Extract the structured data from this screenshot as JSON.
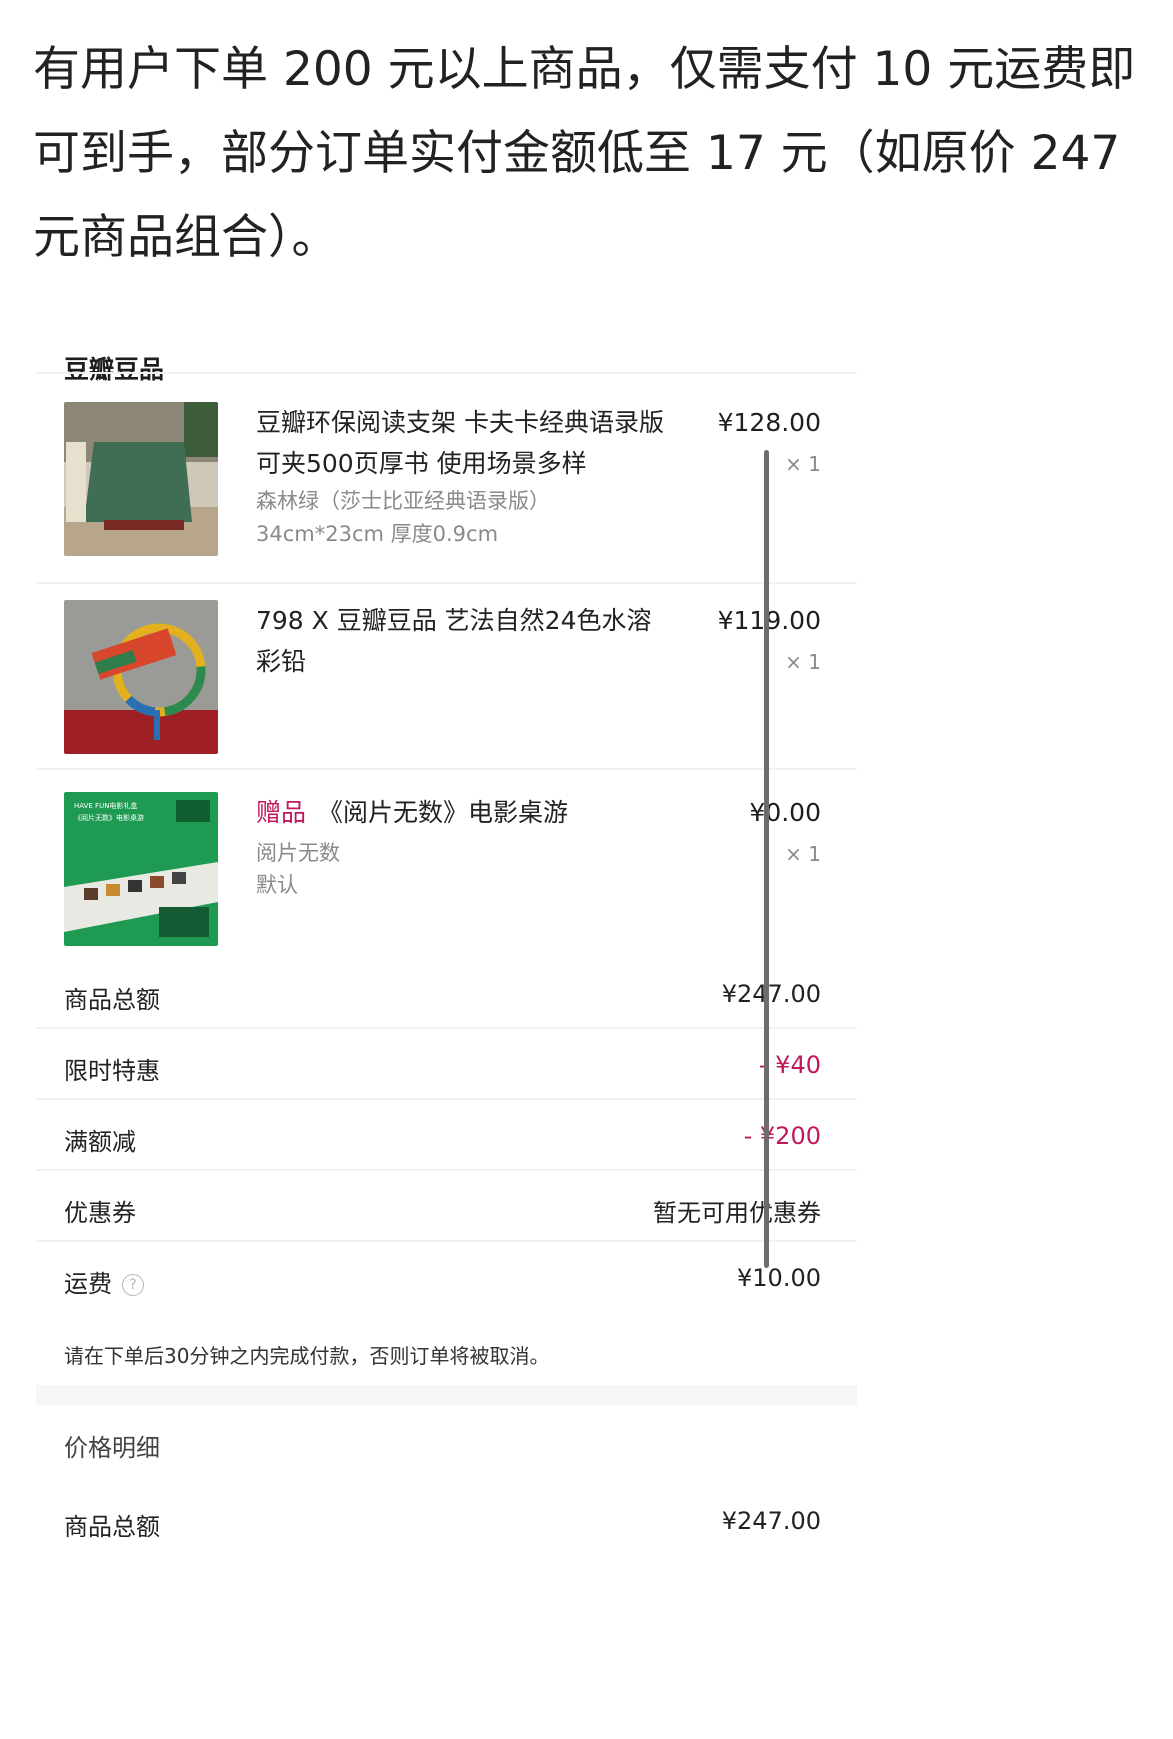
{
  "intro_text": "有用户下单 200 元以上商品，仅需支付 10 元运费即可到手，部分订单实付金额低至 17 元（如原价 247 元商品组合）。",
  "shop_name": "豆瓣豆品",
  "items": [
    {
      "name": "豆瓣环保阅读支架 卡夫卡经典语录版 可夹500页厚书 使用场景多样",
      "spec1": "森林绿（莎士比亚经典语录版）",
      "spec2": "34cm*23cm 厚度0.9cm",
      "price": "¥128.00",
      "qty": "× 1"
    },
    {
      "name": "798 X 豆瓣豆品 艺法自然24色水溶彩铅",
      "price": "¥119.00",
      "qty": "× 1"
    },
    {
      "tag": "赠品",
      "name": "《阅片无数》电影桌游",
      "spec1": "阅片无数",
      "spec2": "默认",
      "price": "¥0.00",
      "qty": "× 1",
      "thumb_text_line1": "HAVE FUN电影礼盒",
      "thumb_text_line2": "《阅片无数》电影桌游"
    }
  ],
  "summary": {
    "goods_total_label": "商品总额",
    "goods_total_value": "¥247.00",
    "limited_label": "限时特惠",
    "limited_value": "- ¥40",
    "full_reduce_label": "满额减",
    "full_reduce_value": "- ¥200",
    "coupon_label": "优惠券",
    "coupon_value": "暂无可用优惠券",
    "shipping_label": "运费",
    "shipping_help": "?",
    "shipping_value": "¥10.00"
  },
  "notice": "请在下单后30分钟之内完成付款，否则订单将被取消。",
  "price_detail": {
    "title": "价格明细",
    "goods_total_label": "商品总额",
    "goods_total_value": "¥247.00"
  },
  "colors": {
    "accent_red": "#c2185b",
    "product_green": "#2e6b50",
    "gift_green": "#1f9a52"
  }
}
